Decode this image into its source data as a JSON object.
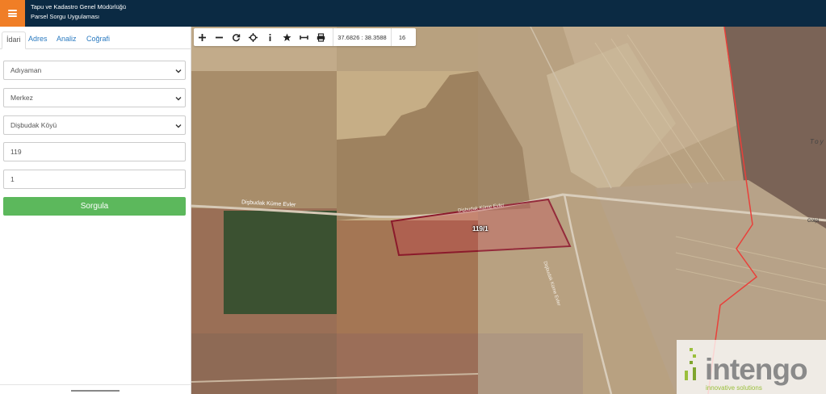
{
  "header": {
    "title_line1": "Tapu ve Kadastro Genel Müdürlüğü",
    "title_line2": "Parsel Sorgu Uygulaması",
    "accent_color": "#f07e26",
    "background_color": "#0b2a43"
  },
  "sidebar": {
    "tabs": [
      {
        "label": "İdari",
        "active": true
      },
      {
        "label": "Adres",
        "active": false
      },
      {
        "label": "Analiz",
        "active": false
      },
      {
        "label": "Coğrafi",
        "active": false
      }
    ],
    "fields": {
      "province": "Adıyaman",
      "district": "Merkez",
      "neighborhood": "Dişbudak Köyü",
      "block": "119",
      "parcel": "1"
    },
    "submit_label": "Sorgula",
    "submit_color": "#5cb85c"
  },
  "toolbar": {
    "tools": [
      "zoom-in-icon",
      "zoom-out-icon",
      "refresh-icon",
      "locate-icon",
      "info-icon",
      "star-icon",
      "measure-icon",
      "print-icon"
    ],
    "coordinates": "37.6826 : 38.3588",
    "zoom_level": "16"
  },
  "map": {
    "road_label_1": "Dişbudak Küme Evler",
    "road_label_2": "Dişbudak Küme Evler",
    "road_label_3": "Dişbudak Küme Evler",
    "parcel_label": "119/1",
    "place_label_1": "Toy",
    "place_label_2": "Gölpi",
    "parcel_color": "#8b1a2b",
    "boundary_color": "#e8302a"
  },
  "watermark": {
    "brand": "intengo",
    "tagline": "innovative solutions"
  }
}
